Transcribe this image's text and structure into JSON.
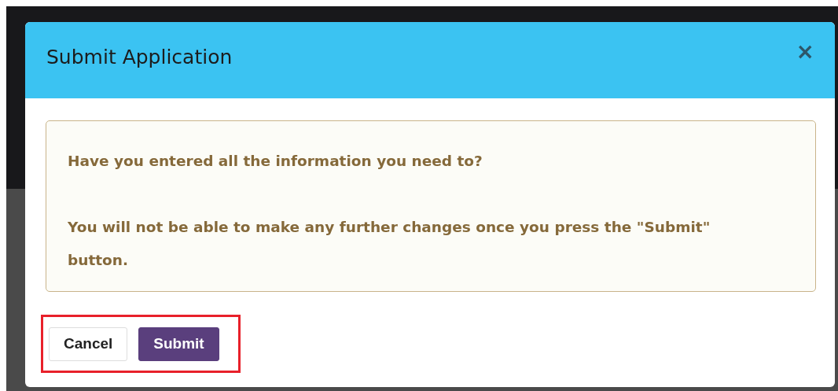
{
  "modal": {
    "title": "Submit Application",
    "close": "×",
    "alert": {
      "paragraphs": [
        "Have you entered all the information you need to?",
        "You will not be able to make any further changes once you press the \"Submit\" button."
      ]
    },
    "buttons": [
      {
        "label": "Cancel",
        "kind": "secondary"
      },
      {
        "label": "Submit",
        "kind": "primary"
      }
    ],
    "buttons_highlighted": true
  }
}
